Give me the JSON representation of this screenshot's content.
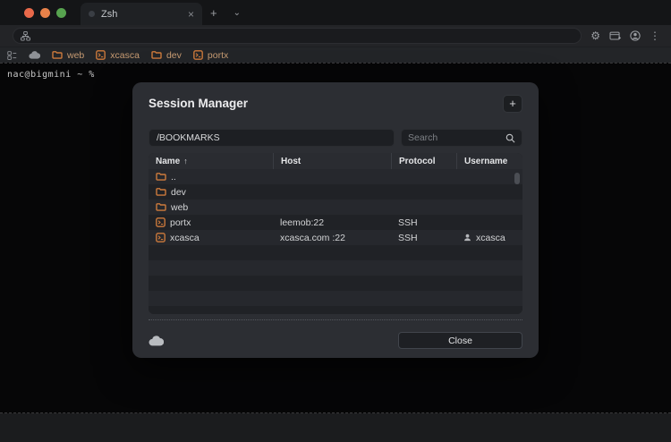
{
  "colors": {
    "accent_orange": "#cd7a3c",
    "traffic_close": "#e9694a",
    "traffic_minimize": "#e9824a",
    "traffic_zoom": "#57a34f",
    "modal_bg": "#2c2e33",
    "terminal_bg": "#060607"
  },
  "titlebar": {
    "tab_label": "Zsh",
    "tab_close": "×",
    "new_tab": "+",
    "tab_list_chevron": "⌄"
  },
  "bookmarks_bar": {
    "items": [
      {
        "label": "web",
        "type": "folder"
      },
      {
        "label": "xcasca",
        "type": "session"
      },
      {
        "label": "dev",
        "type": "folder"
      },
      {
        "label": "portx",
        "type": "session"
      }
    ]
  },
  "terminal": {
    "prompt": "nac@bigmini ~ %"
  },
  "session_manager": {
    "title": "Session Manager",
    "add_button": "+",
    "path_value": "/BOOKMARKS",
    "search_placeholder": "Search",
    "sort_indicator": "↑",
    "columns": {
      "name": "Name",
      "host": "Host",
      "protocol": "Protocol",
      "username": "Username"
    },
    "rows": [
      {
        "name": "..",
        "type": "folder",
        "host": "",
        "protocol": "",
        "username": ""
      },
      {
        "name": "dev",
        "type": "folder",
        "host": "",
        "protocol": "",
        "username": ""
      },
      {
        "name": "web",
        "type": "folder",
        "host": "",
        "protocol": "",
        "username": ""
      },
      {
        "name": "portx",
        "type": "session",
        "host": "leemob:22",
        "protocol": "SSH",
        "username": ""
      },
      {
        "name": "xcasca",
        "type": "session",
        "host": "xcasca.com :22",
        "protocol": "SSH",
        "username": "xcasca"
      }
    ],
    "close_label": "Close"
  }
}
